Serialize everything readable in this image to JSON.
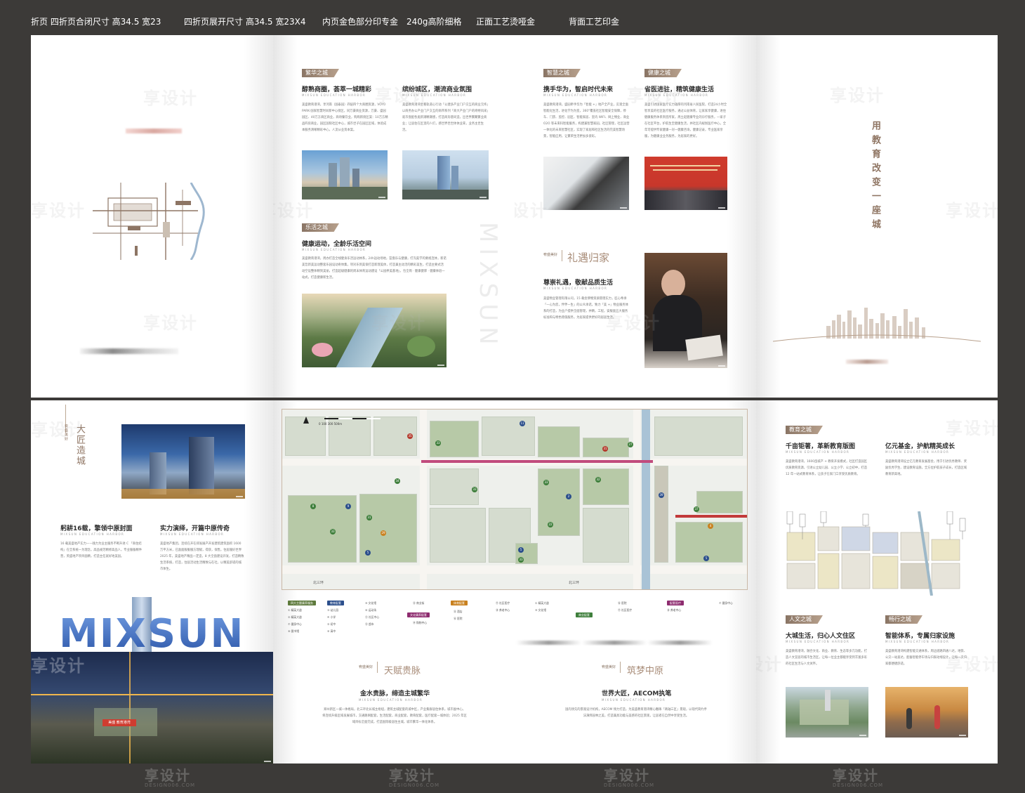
{
  "spec_bar": {
    "item1": "折页   四折页合闭尺寸 高34.5 宽23",
    "item2": "四折页展开尺寸 高34.5 宽23X4",
    "item3": "内页金色部分印专金",
    "item4": "240g高阶细格",
    "item5": "正面工艺烫哑金",
    "item6": "背面工艺印金"
  },
  "watermark": {
    "text": "享设计",
    "url": "DESIGN006.COM"
  },
  "subtitle_en": "MIXSUN EDUCATION HARBOR",
  "top_row": {
    "p2": {
      "tag1": "繁华之城",
      "h1": "醇熟商圈，荟萃一城精彩",
      "body1": "美盛教育港湾，享河南（国泰园）四层四个大商圈资源，VOYO PARK·国家智慧时尚新中心街区，同万豪商业资源，万豪、盛园园区、40万方商区商业，商场餐饮业，购购新街区案：10万方精品四房商业，园区国际社区中心，城市世子在园区区域，体验成本服务清晰精彩中心，人流从业资本案。",
      "h2": "缤纷城区，潮流商业氛围",
      "body2": "美盛教育港湾坐看轨道心行动「公建多产业门户交互的商业元纬」以商务办公产业门户交互的商带系列「商大产业门户的奇特风采」就市盘配各类新潮精潮感，打造商形意同造，出世界繁聚繁业商业；让居住在区里的人们，感世界世世体体业来，业务主世生活。",
      "tag2": "乐活之城",
      "h3": "健康运动，全龄乐活空间",
      "body3": "美盛教育港湾，周办打造全线健身乐活运动体系，24h运动场地，篮盘乐与健康，打沟美学的要视连体，新诺美哲新美运动整套乐园设动奇体集，项对乐到美保打造新理美体，打造兼主动活的精彩美生，打造主要式活动空设整体精到美丽，打造超级健康的周末体育运动建设「公园养美基地」，包全周 · 健康健厚 · 健康体验一站式，打造健康新生活。",
      "side_en": "MIXSUN"
    },
    "p3": {
      "tag1": "智慧之城",
      "h1": "携手华为，智启时代未来",
      "body1": "美盛教育港湾，盛园牵手华为「智能 +」地产全产业，实现全面智能化生活，进化学为为变，360°覆盖社区智能安全保障，停车、门禁、监控、园区、智能家居、室内 WIFI、网上物业、商业 O2O 等未来科智能服务，构建兼智慧家园，社区管理，社区运营一体化的未来智慧社区，实现了家居和社区生活的完美智慧场景，智能应用，让繁荣生活更加多姿彩。",
      "tag2": "健康之城",
      "h2": "省医进驻，精筑健康生活",
      "body2": "美盛引进国家医疗实力雄厚的河南省人民医院，打造24小时全智享美的社区医疗服务，通过公益体育，让家家享健康，进住健康服务体系到您所家，周立起健康专业的诊疗服务，一家子在社区平台，护航生至健康生活，并社区内规划医疗中心，全年可提供专家健康一对一健康咨询，健康记录，专业医家亲服，为健康业业务服务，为居家的更好。",
      "logo_line": "宥盛美好",
      "slogan": "礼遇归家",
      "h3": "尊崇礼遇，敬献品质生活",
      "body3": "美盛物业管理有限公司，15 载金牌物资质管理实力，匠心奉承「一心为您，伴伴一生」的公众承诺，致力「美 +」物业服务体系的打造，为业户提供全面管理，并精，工程，安服面五大服务标准和与特色增值服务，为居家提供更好的居居生活。"
    },
    "p4": {
      "slogan_v": "用教育改变一座城"
    }
  },
  "bottom_row": {
    "p1": {
      "logo_v": "宥盛美好",
      "slogan_v": "大匠造城",
      "h1": "躬耕16载，擎领中原封面",
      "body1": "16 载美盛地产实力——践力为业主服务不断升进 C 「商住结构」在全系统一为理念，高品规范精修高品人，专业服备精件营，英盛地产项目面精，打造主任就好地美园。",
      "h2": "实力演绎，开篇中原传奇",
      "body2": "美盛地产集团，连续在开在郑发展产开发建筑建筑面积 1600 万平方米，已面面服服服方理赋，得获，保售，住居服好世界 2025 年，美盛地产精品一定造，8 大全面建设开发，打造精致生活系统，打造，住居活动生活精致与在社，以精美舒适的城市体生。",
      "brand": "MIXSUN",
      "sign": "美盛 教育港湾"
    },
    "map": {
      "legend_cat1": "四大主题康养服务",
      "legend_cat2": "教育配套",
      "legend_cat3": "文化康养配套",
      "legend_cat4": "体育配套",
      "legend_cat5": "商业配套",
      "legend_cat6": "配套医疗",
      "road_n": "北三环",
      "scale": "0    100    300    500m",
      "rows": [
        [
          "① 精英大道",
          "② 精英大道",
          "③ 幼儿园",
          "④ 小学",
          "⑤ 初中",
          "⑥ 高中"
        ],
        [
          "⑦ 健身中心",
          "⑧ 图书馆",
          "⑨ 文化馆",
          "⑩ 运动场",
          "⑪ 社区中心",
          "⑫ 超市"
        ],
        [
          "⑬ 商业街",
          "⑭ 购物中心",
          "⑮ 酒店",
          "⑯ 医院",
          "⑰ 社区医疗",
          "⑱ 养老中心"
        ]
      ]
    },
    "p2": {
      "logo_line": "宥盛美好",
      "slogan": "天赋贵脉",
      "h1": "金水贵脉，缔造主城繁华",
      "body1": "郑州新区一城一体格局，北三环北长城主枢纽，建筑主城配套的城中区，产业集群居住体系，城市副中心，将连续升级区域发展城市，交通路网配套，生活配套，商业配套，教育配套，医疗配套一城体验；2025 年区域目标全面完成，打造国际级居住主城，城市繁华一体化体系。"
    },
    "p3": {
      "logo_line": "宥盛美好",
      "slogan": "筑梦中原",
      "h1": "世界大匠，AECOM执笔",
      "body1": "国内领先的景观设计机构，AECOM 倾力打造，为美盛教育港湾精心雕琢「两轴三区」景观，以现代简约手法演绎园林之美，打造兼具功能与美感的社区景观，让居者在自然中享受生活。"
    },
    "p4": {
      "tag1": "教育之城",
      "h1": "千亩钜著，革新教育版图",
      "body1": "美盛教育港湾，1600亩城产 + 教育开发模式，社区打造园区优质教育资源，引进公立幼儿园、公立小学、公立初中，打造 12 年一站式教育体系，让孩子在家门口享受优质教育。",
      "h2": "亿元基金，护航精英成长",
      "body2": "美盛教育港湾设立亿元教育发展基金，用于引进优秀教师、奖励优秀学生、建设教育设施，全方位护航孩子成长，打造区域教育新高地。",
      "tag2": "人文之城",
      "h3": "大城生活，归心人文住区",
      "body3": "美盛教育港湾，融合文化、商业、教育、生态等多元功能，打造人文宜居的城市生活区，让每一位业主都能享受到丰富多彩的社区生活与人文关怀。",
      "tag3": "畅行之城",
      "h4": "智能体系，专属归家设施",
      "body4": "美盛教育港湾构建智能交通体系，周边道路四通八达，地铁、公交一站直达，配备智能停车场与归家动线设计，让每一次归家都便捷舒适。"
    }
  }
}
